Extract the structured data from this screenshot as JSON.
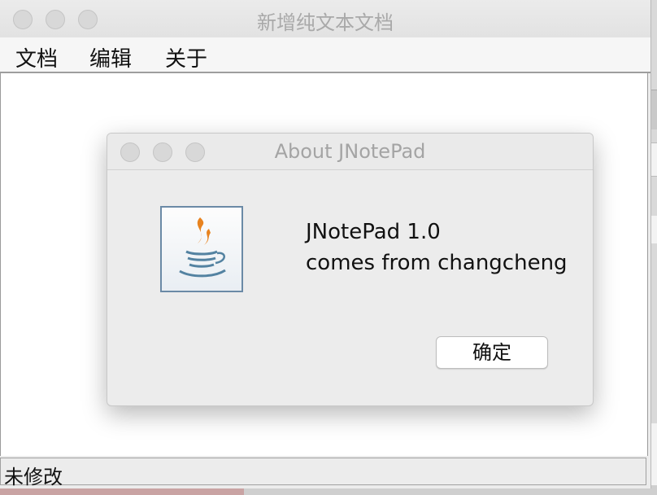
{
  "window": {
    "title": "新增纯文本文档"
  },
  "menubar": {
    "items": [
      {
        "label": "文档"
      },
      {
        "label": "编辑"
      },
      {
        "label": "关于"
      }
    ]
  },
  "editor": {
    "content": ""
  },
  "statusbar": {
    "text": "未修改"
  },
  "dialog": {
    "title": "About JNotePad",
    "icon": "java-logo-icon",
    "line1": "JNotePad 1.0",
    "line2": "comes from changcheng",
    "ok_label": "确定"
  },
  "colors": {
    "java_orange": "#e8831f",
    "java_blue": "#5382a1"
  }
}
